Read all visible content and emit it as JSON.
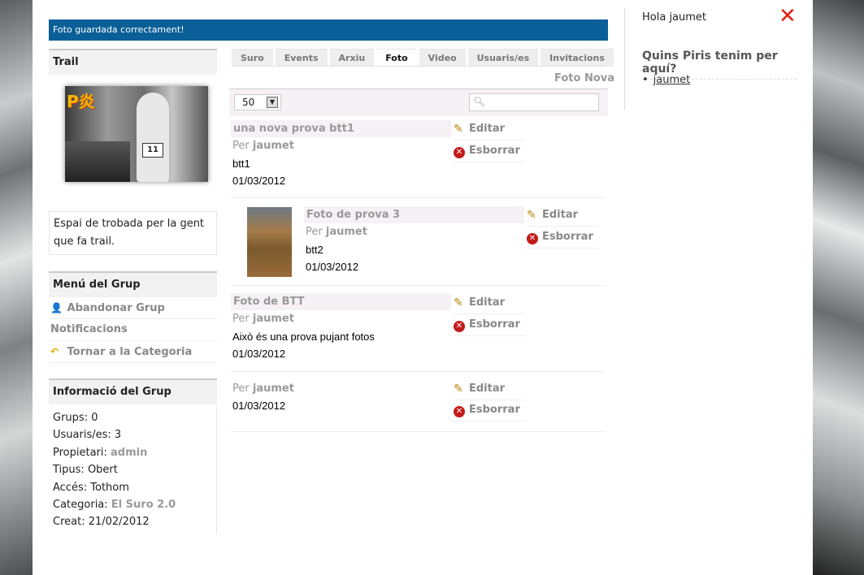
{
  "notice": "Foto guardada correctament!",
  "group": {
    "title": "Trail",
    "description": "Espai de trobada per la gent que fa trail."
  },
  "menu": {
    "title": "Menú del Grup",
    "items": [
      "Abandonar Grup",
      "Notificacions",
      "Tornar a la Categoria"
    ]
  },
  "info": {
    "title": "Informació del Grup",
    "rows": [
      {
        "label": "Grups:",
        "value": "0"
      },
      {
        "label": "Usuaris/es:",
        "value": "3"
      },
      {
        "label": "Propietari:",
        "value": "admin"
      },
      {
        "label": "Tipus:",
        "value": "Obert"
      },
      {
        "label": "Accés:",
        "value": "Tothom"
      },
      {
        "label": "Categoria:",
        "value": "El Suro 2.0"
      },
      {
        "label": "Creat:",
        "value": "21/02/2012"
      }
    ]
  },
  "tabs": [
    "Suro",
    "Events",
    "Arxiu",
    "Foto",
    "Video",
    "Usuaris/es",
    "Invitacions"
  ],
  "active_tab": "Foto",
  "foto_nova": "Foto Nova",
  "per_page": "50",
  "entries": [
    {
      "title": "una nova prova btt1",
      "by": "Per",
      "author": "jaumet",
      "text": "btt1",
      "date": "01/03/2012"
    },
    {
      "title": "Foto de prova 3",
      "by": "Per",
      "author": "jaumet",
      "text": "btt2",
      "date": "01/03/2012"
    },
    {
      "title": "Foto de BTT",
      "by": "Per",
      "author": "jaumet",
      "text": "Això és una prova pujant fotos",
      "date": "01/03/2012"
    },
    {
      "title": "",
      "by": "Per",
      "author": "jaumet",
      "text": "",
      "date": "01/03/2012"
    }
  ],
  "actions": {
    "edit": "Editar",
    "delete": "Esborrar"
  },
  "right": {
    "greeting": "Hola jaumet",
    "who_title": "Quins Piris tenim per aquí?",
    "users": [
      "jaumet"
    ]
  }
}
